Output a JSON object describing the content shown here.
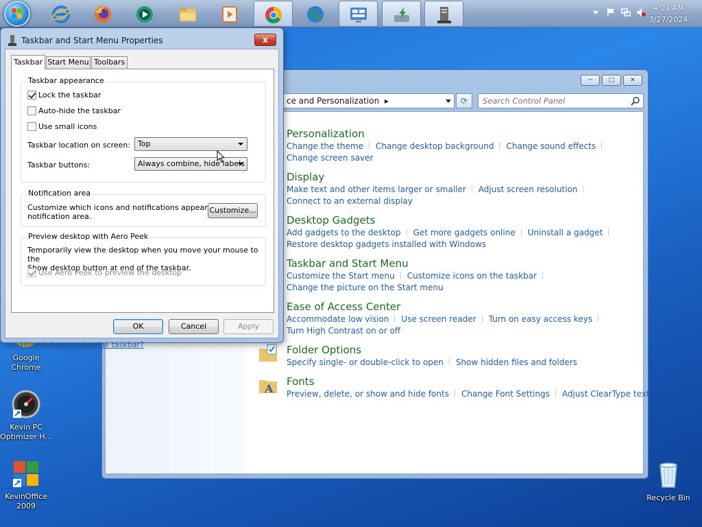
{
  "taskbar": {
    "start_icon": "windows-orb",
    "pinned": [
      {
        "name": "internet-explorer-icon",
        "color": "#2a7fd4"
      },
      {
        "name": "firefox-icon",
        "color": "#e8702a"
      },
      {
        "name": "media-player-icon",
        "color": "#1f9a78"
      },
      {
        "name": "file-explorer-icon",
        "color": "#e9c46a"
      },
      {
        "name": "video-player-icon",
        "color": "#e07a2a"
      },
      {
        "name": "chrome-icon",
        "color": "#4285f4"
      },
      {
        "name": "globe-icon",
        "color": "#2f8f3a"
      },
      {
        "name": "control-panel-icon",
        "color": "#4b86c9"
      },
      {
        "name": "install-arrow-icon",
        "color": "#3a9a3a"
      },
      {
        "name": "taskbar-properties-icon",
        "color": "#555555"
      }
    ],
    "clock": {
      "time": "4:01 AM",
      "date": "3/27/2024"
    }
  },
  "desktop": {
    "icons": [
      {
        "name": "desktop-icon-chrome",
        "label": "Google Chrome"
      },
      {
        "name": "desktop-icon-kevin-pc-optimizer",
        "label": "Kevin PC Optimizer H..."
      },
      {
        "name": "desktop-icon-kevinoffice",
        "label": "KevinOffice 2009"
      },
      {
        "name": "desktop-icon-recycle-bin",
        "label": "Recycle Bin"
      }
    ]
  },
  "control_panel": {
    "address": "ce and Personalization",
    "search_placeholder": "Search Control Panel",
    "categories": [
      {
        "title": "Personalization",
        "links": [
          "Change the theme",
          "Change desktop background",
          "Change sound effects"
        ],
        "links2": [
          "Change screen saver"
        ]
      },
      {
        "title": "Display",
        "links": [
          "Make text and other items larger or smaller",
          "Adjust screen resolution"
        ],
        "links2": [
          "Connect to an external display"
        ]
      },
      {
        "title": "Desktop Gadgets",
        "links": [
          "Add gadgets to the desktop",
          "Get more gadgets online",
          "Uninstall a gadget"
        ],
        "links2": [
          "Restore desktop gadgets installed with Windows"
        ]
      },
      {
        "title": "Taskbar and Start Menu",
        "links": [
          "Customize the Start menu",
          "Customize icons on the taskbar"
        ],
        "links2": [
          "Change the picture on the Start menu"
        ]
      },
      {
        "title": "Ease of Access Center",
        "links": [
          "Accommodate low vision",
          "Use screen reader",
          "Turn on easy access keys"
        ],
        "links2": [
          "Turn High Contrast on or off"
        ]
      },
      {
        "title": "Folder Options",
        "links": [
          "Specify single- or double-click to open",
          "Show hidden files and folders"
        ],
        "links2": []
      },
      {
        "title": "Fonts",
        "links": [
          "Preview, delete, or show and hide fonts",
          "Change Font Settings",
          "Adjust ClearType text"
        ],
        "links2": []
      }
    ]
  },
  "dialog": {
    "title": "Taskbar and Start Menu Properties",
    "close_label": "x",
    "tabs": [
      "Taskbar",
      "Start Menu",
      "Toolbars"
    ],
    "appearance": {
      "title": "Taskbar appearance",
      "lock_label": "Lock the taskbar",
      "lock_checked": true,
      "autohide_label": "Auto-hide the taskbar",
      "autohide_checked": false,
      "small_icons_label": "Use small icons",
      "small_icons_checked": false,
      "location_label": "Taskbar location on screen:",
      "location_value": "Top",
      "buttons_label": "Taskbar buttons:",
      "buttons_value": "Always combine, hide labels"
    },
    "notification": {
      "title": "Notification area",
      "desc_line1": "Customize which icons and notifications appear in the",
      "desc_line2": "notification area.",
      "customize_label": "Customize..."
    },
    "aero_peek": {
      "title": "Preview desktop with Aero Peek",
      "desc_line1": "Temporarily view the desktop when you move your mouse to the",
      "desc_line2": "Show desktop button at end of the taskbar.",
      "checkbox_label": "Use Aero Peek to preview the desktop",
      "checked": true
    },
    "help_link": "How do I customize the taskbar?",
    "ok_label": "OK",
    "cancel_label": "Cancel",
    "apply_label": "Apply"
  }
}
